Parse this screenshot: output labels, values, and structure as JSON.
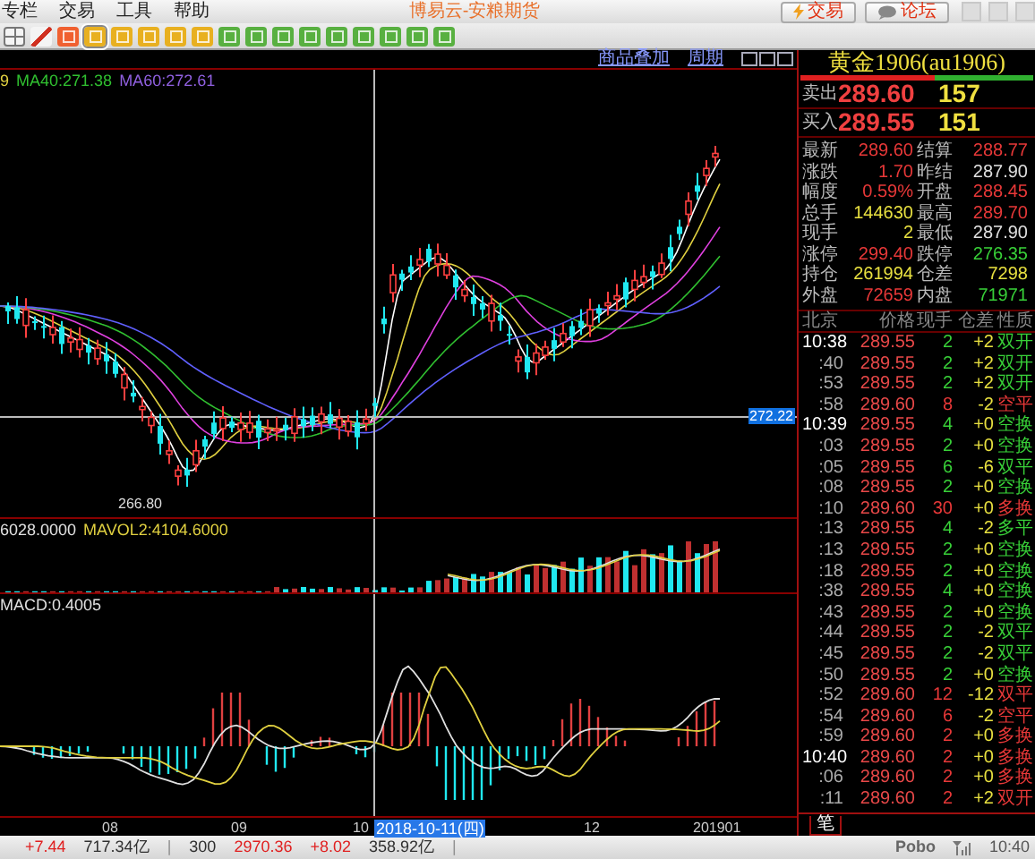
{
  "menu_bar": {
    "items": [
      "专栏",
      "交易",
      "工具",
      "帮助"
    ],
    "title": "博易云-安粮期货",
    "buttons": [
      {
        "label": "交易",
        "kind": "trade"
      },
      {
        "label": "论坛",
        "kind": "forum"
      }
    ]
  },
  "toolbar": [
    {
      "kind": "grid",
      "selected": false
    },
    {
      "kind": "chart",
      "selected": false
    },
    {
      "kind": "orange",
      "selected": false
    },
    {
      "kind": "yellow",
      "selected": true
    },
    {
      "kind": "yellow",
      "selected": false
    },
    {
      "kind": "yellow",
      "selected": false
    },
    {
      "kind": "yellow",
      "selected": false
    },
    {
      "kind": "yellow",
      "selected": false
    },
    {
      "kind": "green",
      "selected": false
    },
    {
      "kind": "green",
      "selected": false
    },
    {
      "kind": "green",
      "selected": false
    },
    {
      "kind": "green",
      "selected": false
    },
    {
      "kind": "green",
      "selected": false
    },
    {
      "kind": "green",
      "selected": false
    },
    {
      "kind": "green",
      "selected": false
    },
    {
      "kind": "green",
      "selected": false
    },
    {
      "kind": "green",
      "selected": false
    }
  ],
  "chart": {
    "links": [
      "商品叠加",
      "周期"
    ],
    "ma_legend": [
      {
        "text": "9",
        "color": "#e0d040"
      },
      {
        "text": "MA40:271.38",
        "color": "#30c030"
      },
      {
        "text": "MA60:272.61",
        "color": "#9060e0"
      }
    ],
    "low_label": "266.80",
    "price_tag": "272.22",
    "volume_legend": [
      {
        "text": "6028.0000",
        "color": "#e0e0e0"
      },
      {
        "text": "MAVOL2:4104.6000",
        "color": "#e0d040"
      }
    ],
    "macd_legend": [
      {
        "text": "MACD:0.4005",
        "color": "#e0e0e0"
      }
    ],
    "x_axis": [
      {
        "label": "08",
        "selected": false
      },
      {
        "label": "09",
        "selected": false
      },
      {
        "label": "10",
        "selected": false
      },
      {
        "label": "2018-10-11(四)",
        "selected": true
      },
      {
        "label": "12",
        "selected": false
      },
      {
        "label": "201901",
        "selected": false
      }
    ]
  },
  "quote": {
    "title": "黄金1906(au1906)",
    "ratio_bar": {
      "level": 0.58
    },
    "book": [
      {
        "label": "卖出",
        "price": "289.60",
        "volume": "157"
      },
      {
        "label": "买入",
        "price": "289.55",
        "volume": "151"
      }
    ],
    "stats": [
      {
        "label": "最新",
        "value": "289.60",
        "color": "#e83838"
      },
      {
        "label": "结算",
        "value": "288.77",
        "color": "#e83838"
      },
      {
        "label": "涨跌",
        "value": "1.70",
        "color": "#e83838"
      },
      {
        "label": "昨结",
        "value": "287.90",
        "color": "#e0e0e0"
      },
      {
        "label": "幅度",
        "value": "0.59%",
        "color": "#e83838"
      },
      {
        "label": "开盘",
        "value": "288.45",
        "color": "#e83838"
      },
      {
        "label": "总手",
        "value": "144630",
        "color": "#e8e040"
      },
      {
        "label": "最高",
        "value": "289.70",
        "color": "#e83838"
      },
      {
        "label": "现手",
        "value": "2",
        "color": "#e8e040"
      },
      {
        "label": "最低",
        "value": "287.90",
        "color": "#e0e0e0"
      },
      {
        "label": "涨停",
        "value": "299.40",
        "color": "#e83838"
      },
      {
        "label": "跌停",
        "value": "276.35",
        "color": "#38d038"
      },
      {
        "label": "持仓",
        "value": "261994",
        "color": "#e8e040"
      },
      {
        "label": "仓差",
        "value": "7298",
        "color": "#e8e040"
      },
      {
        "label": "外盘",
        "value": "72659",
        "color": "#e83838"
      },
      {
        "label": "内盘",
        "value": "71971",
        "color": "#38d038"
      }
    ],
    "trades": {
      "columns": [
        "北京",
        "价格",
        "现手",
        "仓差",
        "性质"
      ],
      "rows": [
        {
          "time": "10:38",
          "kind": "minute",
          "price": "289.55",
          "volume": "2",
          "change": "+2",
          "nature": "双开",
          "color": "#38d038"
        },
        {
          "time": ":40",
          "kind": "second",
          "price": "289.55",
          "volume": "2",
          "change": "+2",
          "nature": "双开",
          "color": "#38d038"
        },
        {
          "time": ":53",
          "kind": "second",
          "price": "289.55",
          "volume": "2",
          "change": "+2",
          "nature": "双开",
          "color": "#38d038"
        },
        {
          "time": ":58",
          "kind": "second",
          "price": "289.60",
          "volume": "8",
          "change": "-2",
          "nature": "空平",
          "color": "#e83838"
        },
        {
          "time": "10:39",
          "kind": "minute",
          "price": "289.55",
          "volume": "4",
          "change": "+0",
          "nature": "空换",
          "color": "#38d038"
        },
        {
          "time": ":03",
          "kind": "second",
          "price": "289.55",
          "volume": "2",
          "change": "+0",
          "nature": "空换",
          "color": "#38d038"
        },
        {
          "time": ":05",
          "kind": "second",
          "price": "289.55",
          "volume": "6",
          "change": "-6",
          "nature": "双平",
          "color": "#38d038"
        },
        {
          "time": ":08",
          "kind": "second",
          "price": "289.55",
          "volume": "2",
          "change": "+0",
          "nature": "空换",
          "color": "#38d038"
        },
        {
          "time": ":10",
          "kind": "second",
          "price": "289.60",
          "volume": "30",
          "change": "+0",
          "nature": "多换",
          "color": "#e83838"
        },
        {
          "time": ":13",
          "kind": "second",
          "price": "289.55",
          "volume": "4",
          "change": "-2",
          "nature": "多平",
          "color": "#38d038"
        },
        {
          "time": ":13",
          "kind": "second",
          "price": "289.55",
          "volume": "2",
          "change": "+0",
          "nature": "空换",
          "color": "#38d038"
        },
        {
          "time": ":18",
          "kind": "second",
          "price": "289.55",
          "volume": "2",
          "change": "+0",
          "nature": "空换",
          "color": "#38d038"
        },
        {
          "time": ":38",
          "kind": "second",
          "price": "289.55",
          "volume": "4",
          "change": "+0",
          "nature": "空换",
          "color": "#38d038"
        },
        {
          "time": ":43",
          "kind": "second",
          "price": "289.55",
          "volume": "2",
          "change": "+0",
          "nature": "空换",
          "color": "#38d038"
        },
        {
          "time": ":44",
          "kind": "second",
          "price": "289.55",
          "volume": "2",
          "change": "-2",
          "nature": "双平",
          "color": "#38d038"
        },
        {
          "time": ":45",
          "kind": "second",
          "price": "289.55",
          "volume": "2",
          "change": "-2",
          "nature": "双平",
          "color": "#38d038"
        },
        {
          "time": ":50",
          "kind": "second",
          "price": "289.55",
          "volume": "2",
          "change": "+0",
          "nature": "空换",
          "color": "#38d038"
        },
        {
          "time": ":52",
          "kind": "second",
          "price": "289.60",
          "volume": "12",
          "change": "-12",
          "nature": "双平",
          "color": "#e83838"
        },
        {
          "time": ":54",
          "kind": "second",
          "price": "289.60",
          "volume": "6",
          "change": "-2",
          "nature": "空平",
          "color": "#e83838"
        },
        {
          "time": ":59",
          "kind": "second",
          "price": "289.60",
          "volume": "2",
          "change": "+0",
          "nature": "多换",
          "color": "#e83838"
        },
        {
          "time": "10:40",
          "kind": "minute",
          "price": "289.60",
          "volume": "2",
          "change": "+0",
          "nature": "多换",
          "color": "#e83838"
        },
        {
          "time": ":06",
          "kind": "second",
          "price": "289.60",
          "volume": "2",
          "change": "+0",
          "nature": "多换",
          "color": "#e83838"
        },
        {
          "time": ":11",
          "kind": "second",
          "price": "289.60",
          "volume": "2",
          "change": "+2",
          "nature": "双开",
          "color": "#e83838"
        }
      ]
    },
    "tab": "笔"
  },
  "status_bar": {
    "items": [
      {
        "text": "+7.44",
        "color": "#e02020"
      },
      {
        "text": "717.34亿",
        "color": "#303030"
      },
      {
        "text": "|",
        "color": "#909090"
      },
      {
        "text": "300",
        "color": "#303030"
      },
      {
        "text": "2970.36",
        "color": "#e02020"
      },
      {
        "text": "+8.02",
        "color": "#e02020"
      },
      {
        "text": "358.92亿",
        "color": "#303030"
      },
      {
        "text": "|",
        "color": "#909090"
      }
    ],
    "brand": "Pobo",
    "time": "10:40"
  }
}
